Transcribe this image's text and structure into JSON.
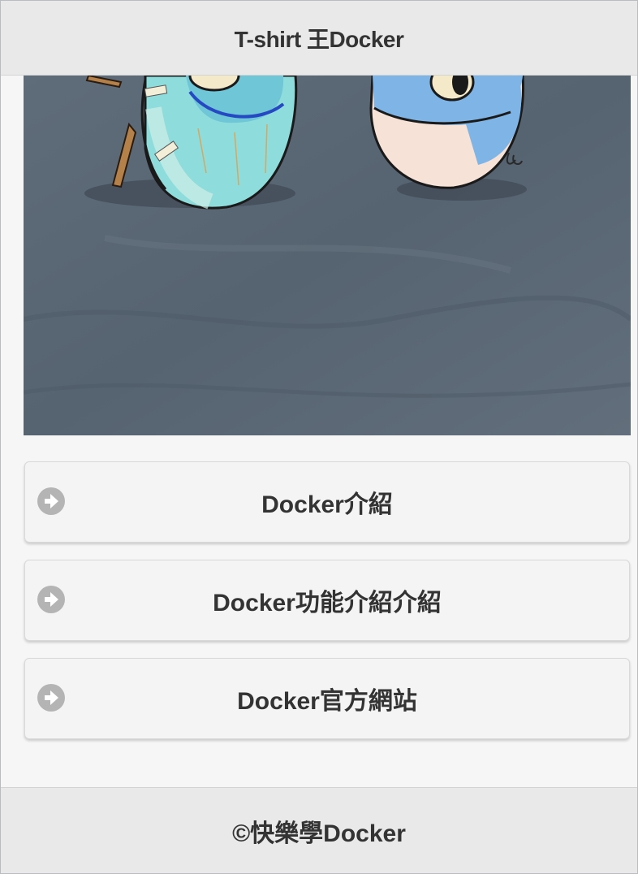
{
  "header": {
    "title": "T-shirt 王Docker"
  },
  "photo": {
    "alt_icon": "docker-tshirt-photo"
  },
  "buttons": [
    {
      "label": "Docker介紹",
      "icon": "arrow-right-icon"
    },
    {
      "label": "Docker功能介紹介紹",
      "icon": "arrow-right-icon"
    },
    {
      "label": "Docker官方網站",
      "icon": "arrow-right-icon"
    }
  ],
  "footer": {
    "text": "©快樂學Docker"
  },
  "colors": {
    "header_bg": "#e9e9e9",
    "shirt": "#5a6775",
    "icon_gray": "#b4b4b4"
  }
}
